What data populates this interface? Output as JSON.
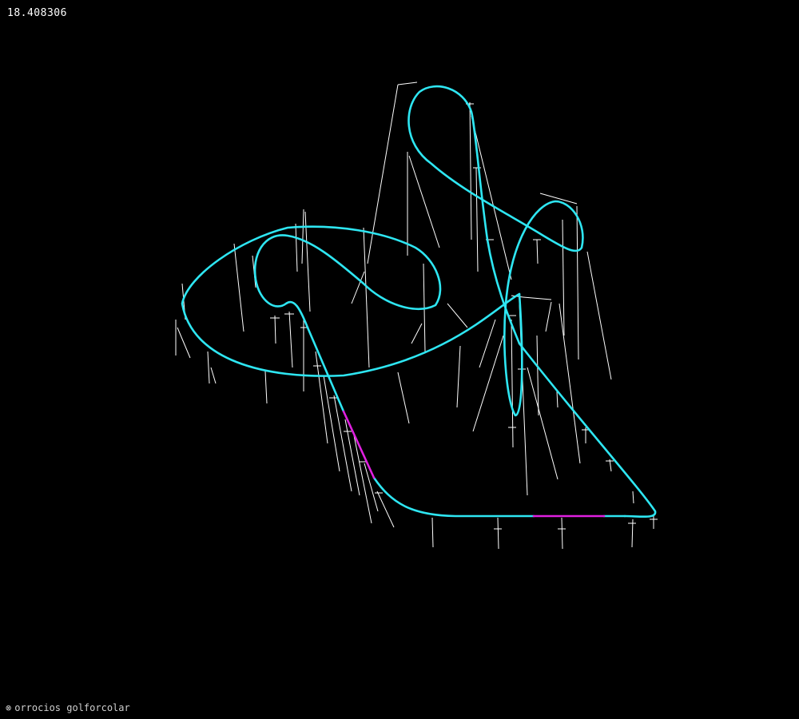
{
  "hud": {
    "frame_value": "18.408306",
    "status_text": "orrocios golforcolar"
  },
  "scene": {
    "track_color": "#2ee6f2",
    "highlight_color": "#e020e0",
    "support_color": "#ffffff",
    "background": "#000000"
  }
}
